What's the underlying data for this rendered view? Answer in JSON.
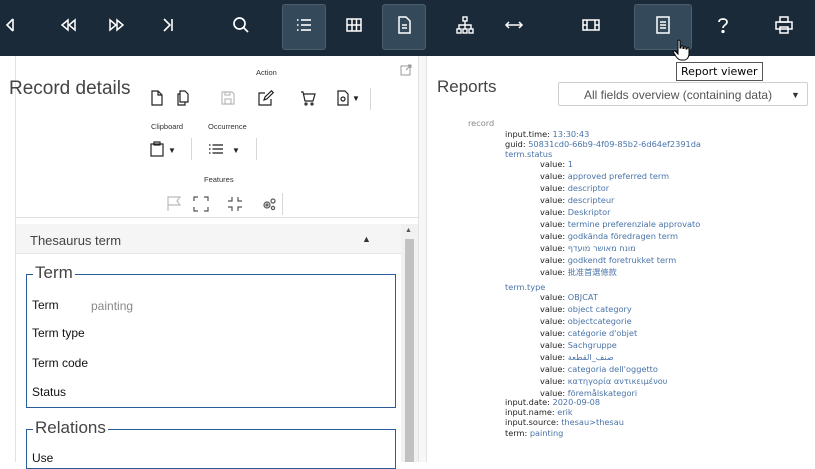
{
  "toolbar": {
    "buttons": [
      {
        "name": "first-record-button",
        "icon": "skip-first-icon"
      },
      {
        "name": "previous-record-button",
        "icon": "rewind-icon"
      },
      {
        "name": "next-record-button",
        "icon": "fast-forward-icon"
      },
      {
        "name": "last-record-button",
        "icon": "skip-last-icon"
      },
      {
        "name": "search-button",
        "icon": "search-icon"
      },
      {
        "name": "list-view-button",
        "icon": "list-icon"
      },
      {
        "name": "grid-view-button",
        "icon": "grid-icon"
      },
      {
        "name": "detail-view-button",
        "icon": "document-icon"
      },
      {
        "name": "hierarchy-view-button",
        "icon": "hierarchy-icon"
      },
      {
        "name": "expand-button",
        "icon": "horizontal-arrows-icon"
      },
      {
        "name": "media-viewer-button",
        "icon": "film-icon"
      },
      {
        "name": "report-viewer-button",
        "icon": "report-icon"
      },
      {
        "name": "help-button",
        "icon": "help-icon"
      },
      {
        "name": "print-button",
        "icon": "printer-icon"
      }
    ],
    "tooltip": "Report viewer"
  },
  "record": {
    "title": "Record details",
    "groups": {
      "action": "Action",
      "clipboard": "Clipboard",
      "occurrence": "Occurrence",
      "features": "Features"
    }
  },
  "thesaurus": {
    "header": "Thesaurus term",
    "term_section": "Term",
    "fields": [
      {
        "label": "Term",
        "value": "painting"
      },
      {
        "label": "Term type",
        "value": ""
      },
      {
        "label": "Term code",
        "value": ""
      },
      {
        "label": "Status",
        "value": ""
      }
    ],
    "relations_section": "Relations",
    "relations_fields": [
      {
        "label": "Use"
      }
    ]
  },
  "reports": {
    "title": "Reports",
    "selected_report": "All fields overview (containing data)",
    "root": "record",
    "lines": {
      "input_time_k": "input.time:",
      "input_time_v": " 13:30:43",
      "guid_k": "guid:",
      "guid_v": " 50831cd0-66b9-4f09-85b2-6d64ef2391da",
      "term_status": "term.status",
      "status_values": [
        "1",
        "approved preferred term",
        "descriptor",
        "descripteur",
        "Deskriptor",
        "termine preferenziale approvato",
        "godkända föredragen term",
        "מונח מאושר מועדף",
        "godkendt foretrukket term",
        "批准首選條款"
      ],
      "term_type": "term.type",
      "type_values": [
        "OBJCAT",
        "object category",
        "objectcategorie",
        "catégorie d'objet",
        "Sachgruppe",
        "صنف_القطعة",
        "categoria dell'oggetto",
        "κατηγορία αντικειμένου",
        "föremålskategori"
      ],
      "value_k": "value:",
      "input_date_k": "input.date:",
      "input_date_v": " 2020-09-08",
      "input_name_k": "input.name:",
      "input_name_v": " erik",
      "input_source_k": "input.source:",
      "input_source_v": " thesau>thesau",
      "term_k": "term:",
      "term_v": " painting"
    }
  }
}
